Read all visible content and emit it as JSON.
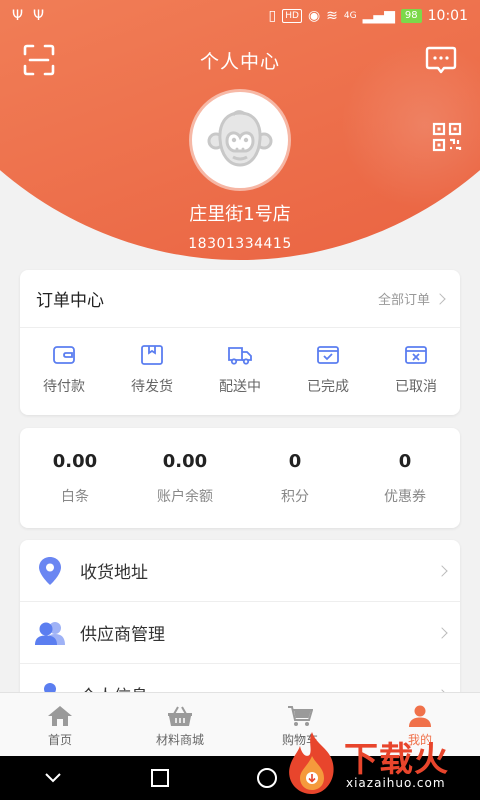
{
  "status_bar": {
    "hd": "HD",
    "network": "4G",
    "battery": "98",
    "time": "10:01"
  },
  "header": {
    "title": "个人中心"
  },
  "profile": {
    "name": "庄里街1号店",
    "phone": "18301334415"
  },
  "orders": {
    "title": "订单中心",
    "all_label": "全部订单",
    "items": [
      {
        "label": "待付款",
        "icon": "wallet-icon"
      },
      {
        "label": "待发货",
        "icon": "box-icon"
      },
      {
        "label": "配送中",
        "icon": "truck-icon"
      },
      {
        "label": "已完成",
        "icon": "completed-icon"
      },
      {
        "label": "已取消",
        "icon": "cancelled-icon"
      }
    ]
  },
  "assets": [
    {
      "value": "0.00",
      "label": "白条"
    },
    {
      "value": "0.00",
      "label": "账户余额"
    },
    {
      "value": "0",
      "label": "积分"
    },
    {
      "value": "0",
      "label": "优惠券"
    }
  ],
  "menu": [
    {
      "label": "收货地址",
      "icon": "location-pin-icon"
    },
    {
      "label": "供应商管理",
      "icon": "users-icon"
    },
    {
      "label": "个人信息",
      "icon": "person-icon"
    }
  ],
  "tabs": [
    {
      "label": "首页",
      "icon": "home-icon"
    },
    {
      "label": "材料商城",
      "icon": "basket-icon"
    },
    {
      "label": "购物车",
      "icon": "cart-icon"
    },
    {
      "label": "我的",
      "icon": "user-icon"
    }
  ],
  "watermark": {
    "title": "下载火",
    "url": "xiazaihuo.com"
  },
  "colors": {
    "accent": "#f0714a",
    "icon_blue": "#5b7ef0"
  }
}
